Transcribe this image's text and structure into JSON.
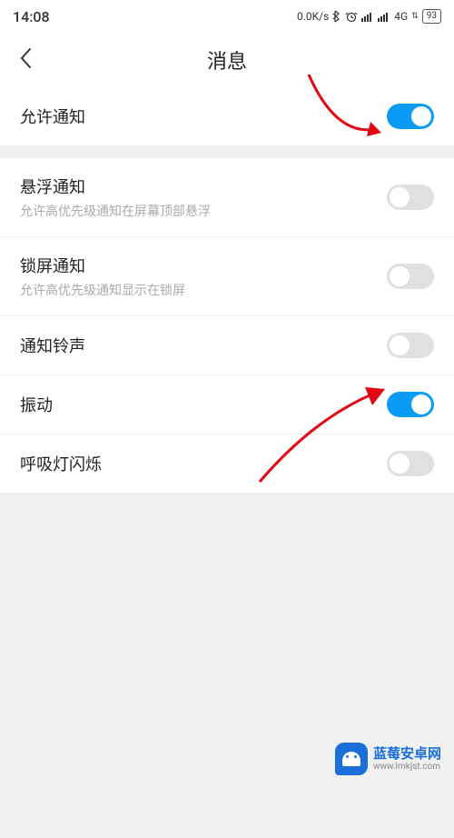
{
  "status_bar": {
    "time": "14:08",
    "speed": "0.0K/s",
    "network": "4G",
    "battery": "93"
  },
  "header": {
    "title": "消息"
  },
  "sections": {
    "allow_notification": {
      "title": "允许通知",
      "enabled": true
    },
    "floating_notification": {
      "title": "悬浮通知",
      "subtitle": "允许高优先级通知在屏幕顶部悬浮",
      "enabled": false
    },
    "lockscreen_notification": {
      "title": "锁屏通知",
      "subtitle": "允许高优先级通知显示在锁屏",
      "enabled": false
    },
    "ringtone": {
      "title": "通知铃声",
      "enabled": false
    },
    "vibration": {
      "title": "振动",
      "enabled": true
    },
    "breathing_light": {
      "title": "呼吸灯闪烁",
      "enabled": false
    }
  },
  "watermark": {
    "title": "蓝莓安卓网",
    "url": "www.lmkjst.com"
  }
}
